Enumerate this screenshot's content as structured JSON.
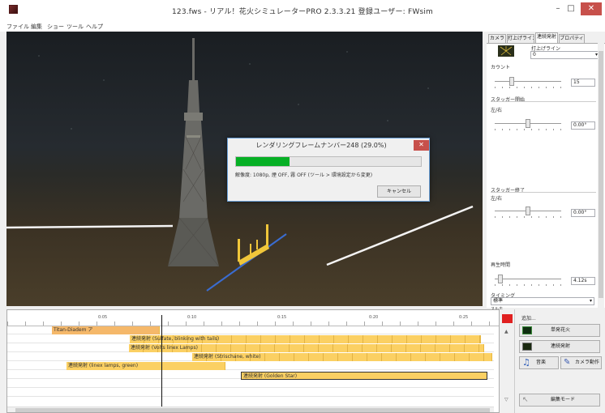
{
  "window": {
    "title": "123.fws - リアル！花火シミュレーターPRO 2.3.3.21 登録ユーザー: FWsim",
    "minimize": "–",
    "maximize": "□",
    "close": "✕"
  },
  "menu": [
    "ファイル",
    "編集",
    "ショー",
    "ツール",
    "ヘルプ"
  ],
  "dialog": {
    "title": "レンダリングフレームナンバー248 (29.0%)",
    "progress": 0.29,
    "info": "解像度: 1080p, 煙 OFF, 霧 OFF (ツール > 環境設定から変更)",
    "cancel": "キャンセル",
    "close": "✕"
  },
  "panel": {
    "tabs": [
      "カメラ",
      "打上げライン",
      "連続発射",
      "プロパティ"
    ],
    "launch_line_label": "打上げライン",
    "launch_line_value": "0",
    "count_label": "カウント",
    "count_value": "15",
    "stagger_start_label": "スタッガー開始",
    "stagger_start_sub": "左/右",
    "stagger_start_value": "0.00°",
    "stagger_end_label": "スタッガー終了",
    "stagger_end_sub": "左/右",
    "stagger_end_value": "0.00°",
    "duration_label": "再生時間",
    "duration_value": "4.12s",
    "timing_label": "タイミング",
    "timing_value": "標準",
    "bottom_cut": "スルホ"
  },
  "timeline": {
    "ruler": [
      "0:05",
      "0:10",
      "0:15",
      "0:20",
      "0:25"
    ],
    "clips": [
      {
        "label": "Titan-Diadem ア"
      },
      {
        "label": "連続発射 (Sulfate, blinking with tails)"
      },
      {
        "label": "連続発射 (Volts linex Lamps)"
      },
      {
        "label": "連続発射 (Strischane, white)"
      },
      {
        "label": "連続発射 (linex lamps, green)"
      },
      {
        "label": "連続発射 (Golden Star)"
      }
    ]
  },
  "actions": {
    "add_label": "追加...",
    "single_shot": "単発花火",
    "continuous": "連続発射",
    "music": "音楽",
    "camera_move": "カメラ動作",
    "edit_mode": "編集モード"
  },
  "colors": {
    "clip": "#fbd063",
    "progress": "#06b025",
    "record": "#e02020"
  }
}
